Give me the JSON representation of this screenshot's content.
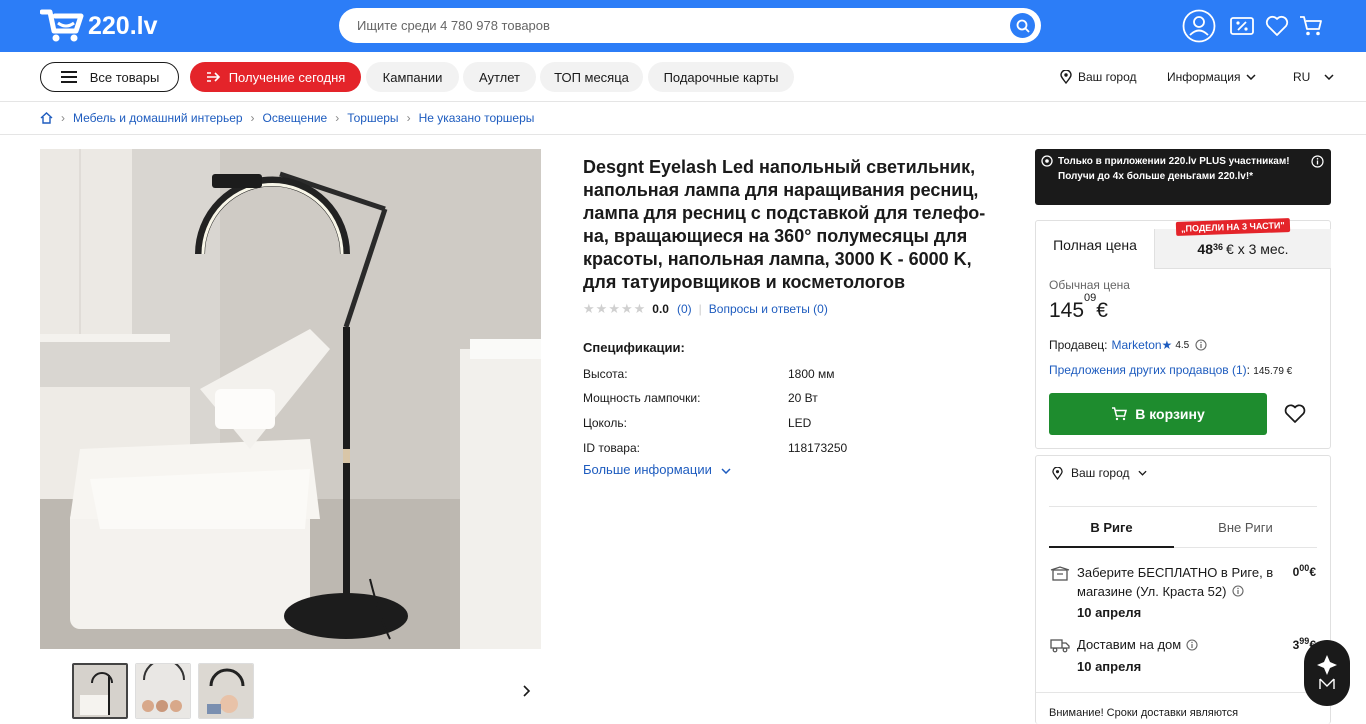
{
  "header": {
    "logo_text": "220.lv",
    "search_placeholder": "Ищите среди 4 780 978 товаров",
    "icons": [
      "account-icon",
      "percent-icon",
      "heart-icon",
      "cart-icon"
    ]
  },
  "nav": {
    "all_products": "Все товары",
    "get_today": "Получение сегодня",
    "campaigns": "Кампании",
    "outlet": "Аутлет",
    "top_month": "ТОП месяца",
    "gift_cards": "Подарочные карты",
    "city": "Ваш город",
    "info": "Информация",
    "lang": "RU"
  },
  "breadcrumb": [
    "Мебель и домашний интерьер",
    "Освещение",
    "Торшеры",
    "Не указано торшеры"
  ],
  "product": {
    "title": "Desgnt Eyelash Led напольный светильник, напольная лампа для наращивания ресниц, лампа для ресниц с подставкой для телефо-на, вращающиеся на 360° полумесяцы для красоты, напольная лампа, 3000 K - 6000 K, для татуировщиков и косметологов",
    "rating": "0.0",
    "reviews": "(0)",
    "qa": "Вопросы и ответы (0)",
    "specs_title": "Спецификации:",
    "specs": [
      {
        "k": "Высота:",
        "v": "1800 мм"
      },
      {
        "k": "Мощность лампочки:",
        "v": "20 Вт"
      },
      {
        "k": "Цоколь:",
        "v": "LED"
      },
      {
        "k": "ID товара:",
        "v": "118173250"
      }
    ],
    "more_info": "Больше информации"
  },
  "promo": {
    "text": "Только в приложении 220.lv PLUS участникам! Получи до 4х больше деньгами 220.lv!*"
  },
  "buybox": {
    "tab_full": "Полная цена",
    "badge": "„ПОДЕЛИ НА 3 ЧАСТИ\"",
    "installment_int": "48",
    "installment_cents": "36",
    "installment_tail": "€ x 3 мес.",
    "regular_label": "Обычная цена",
    "price_int": "145",
    "price_cents": "09",
    "currency": "€",
    "seller_label": "Продавец:",
    "seller": "Marketon",
    "seller_rating": "4.5",
    "other_offers": "Предложения других продавцов (1)",
    "other_price": "145.79 €",
    "cart_label": "В корзину"
  },
  "delivery": {
    "city": "Ваш город",
    "tab_riga": "В Риге",
    "tab_outside": "Вне Риги",
    "pickup_text": "Заберите БЕСПЛАТНО в Риге, в магазине (Ул. Краста 52)",
    "pickup_date": "10 апреля",
    "pickup_price_int": "0",
    "pickup_price_cents": "00",
    "home_text": "Доставим на дом",
    "home_date": "10 апреля",
    "home_price_int": "3",
    "home_price_cents": "99",
    "note": "Внимание! Сроки доставки являются"
  }
}
